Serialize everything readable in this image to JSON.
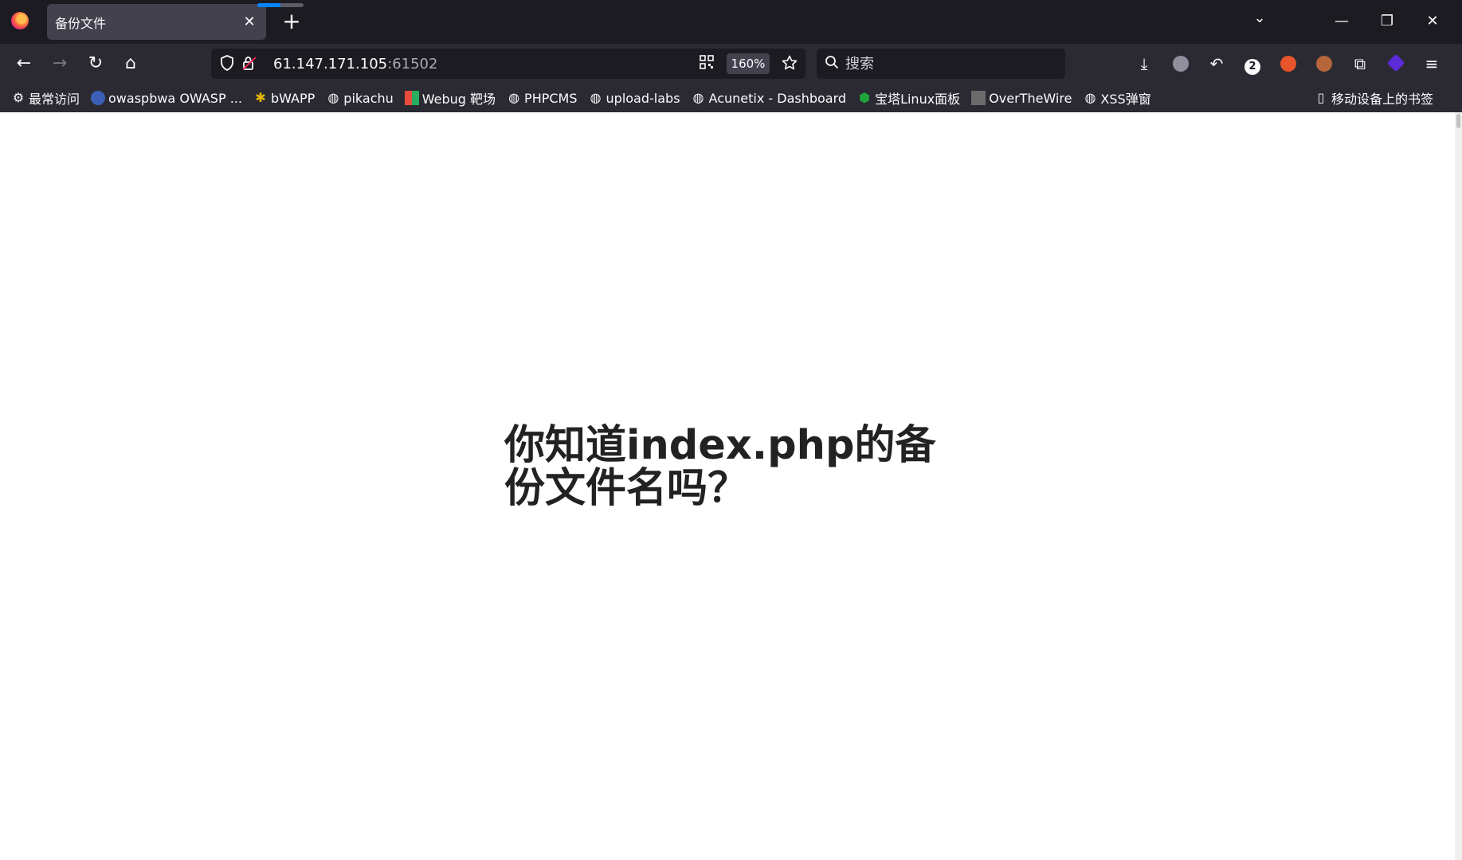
{
  "tab": {
    "title": "备份文件",
    "close": "✕"
  },
  "tabstrip": {
    "new_tab": "+",
    "list": "⌄",
    "minimize": "—",
    "restore": "❐",
    "close": "✕"
  },
  "nav": {
    "back": "←",
    "forward": "→",
    "reload": "↻",
    "home": "⌂"
  },
  "url": {
    "host": "61.147.171.105",
    "port": ":61502",
    "zoom": "160%"
  },
  "search": {
    "placeholder": "搜索"
  },
  "toolbar": {
    "download": "⤓",
    "reply": "↶",
    "badge_count": "2",
    "extensions": "⧉",
    "menu": "≡"
  },
  "bookmarks": [
    {
      "label": "最常访问",
      "icon": "gear-icon"
    },
    {
      "label": "owaspbwa OWASP ...",
      "icon": "owasp-icon"
    },
    {
      "label": "bWAPP",
      "icon": "bee-icon"
    },
    {
      "label": "pikachu",
      "icon": "globe-icon"
    },
    {
      "label": "Webug 靶场",
      "icon": "webug-icon"
    },
    {
      "label": "PHPCMS",
      "icon": "globe-icon"
    },
    {
      "label": "upload-labs",
      "icon": "globe-icon"
    },
    {
      "label": "Acunetix - Dashboard",
      "icon": "globe-icon"
    },
    {
      "label": "宝塔Linux面板",
      "icon": "baota-icon"
    },
    {
      "label": "OverTheWire",
      "icon": "otw-icon"
    },
    {
      "label": "XSS弹窗",
      "icon": "globe-icon"
    }
  ],
  "mobile_bookmarks": "移动设备上的书签",
  "page": {
    "heading": "你知道index.php的备份文件名吗？"
  }
}
